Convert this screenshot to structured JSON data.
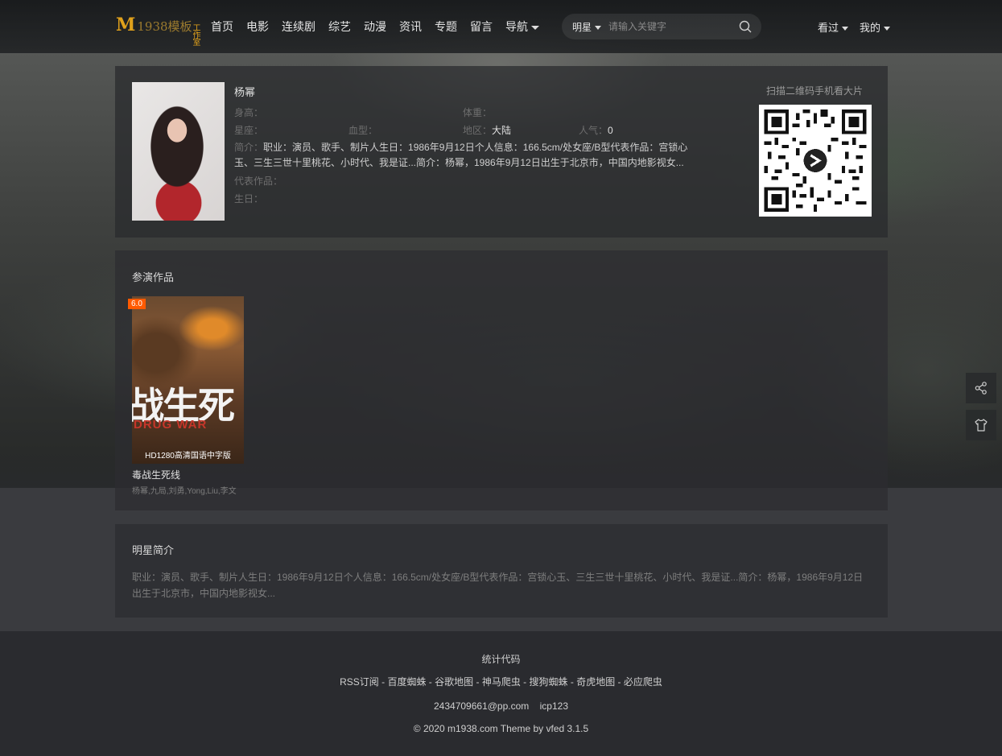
{
  "header": {
    "logo": {
      "m": "M",
      "rest": "1938模板",
      "stack_top": "工",
      "stack_mid": "作",
      "stack_bot": "室"
    },
    "nav": [
      "首页",
      "电影",
      "连续剧",
      "综艺",
      "动漫",
      "资讯",
      "专题",
      "留言"
    ],
    "nav_more": "导航",
    "search": {
      "type": "明星",
      "placeholder": "请输入关键字"
    },
    "user_menu": {
      "history": "看过",
      "mine": "我的"
    }
  },
  "profile": {
    "name": "杨幂",
    "height_label": "身高：",
    "weight_label": "体重：",
    "constellation_label": "星座：",
    "blood_label": "血型：",
    "area_label": "地区：",
    "area_value": "大陆",
    "popularity_label": "人气：",
    "popularity_value": "0",
    "desc_label": "简介：",
    "desc_value": "职业：演员、歌手、制片人生日：1986年9月12日个人信息：166.5cm/处女座/B型代表作品：宫锁心玉、三生三世十里桃花、小时代、我是证...简介：杨幂，1986年9月12日出生于北京市，中国内地影视女...",
    "works_label": "代表作品：",
    "birthday_label": "生日：",
    "qr_title": "扫描二维码手机看大片"
  },
  "works": {
    "title": "参演作品",
    "items": [
      {
        "score": "6.0",
        "poster_text": "战生死",
        "poster_en": "DRUG WAR",
        "note": "HD1280高清国语中字版",
        "title": "毒战生死线",
        "cast": "杨幂,九局,刘勇,Yong,Liu,李文"
      }
    ]
  },
  "intro": {
    "title": "明星简介",
    "text": "职业：演员、歌手、制片人生日：1986年9月12日个人信息：166.5cm/处女座/B型代表作品：宫锁心玉、三生三世十里桃花、小时代、我是证...简介：杨幂，1986年9月12日出生于北京市，中国内地影视女..."
  },
  "footer": {
    "stats": "统计代码",
    "links": [
      "RSS订阅",
      "百度蜘蛛",
      "谷歌地图",
      "神马爬虫",
      "搜狗蜘蛛",
      "奇虎地图",
      "必应爬虫"
    ],
    "email": "2434709661@pp.com",
    "icp": "icp123",
    "copyright": "© 2020 m1938.com Theme by vfed 3.1.5"
  },
  "colors": {
    "accent": "#e0a11b",
    "score_badge": "#ff5a00",
    "background": "#2a2b2f"
  },
  "icons": [
    "search-icon",
    "share-icon",
    "theme-icon",
    "qr-code"
  ]
}
